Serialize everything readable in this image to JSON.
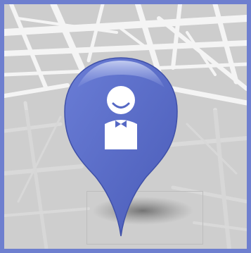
{
  "graphic": {
    "frame_color": "#6e7fcf",
    "map_background_color": "#c9c9c9",
    "street_color": "#ffffff",
    "pin_color": "#5568c4",
    "pin_highlight_color": "#8a99dd",
    "person_color": "#ffffff",
    "icon": "location-pin-person-icon"
  }
}
